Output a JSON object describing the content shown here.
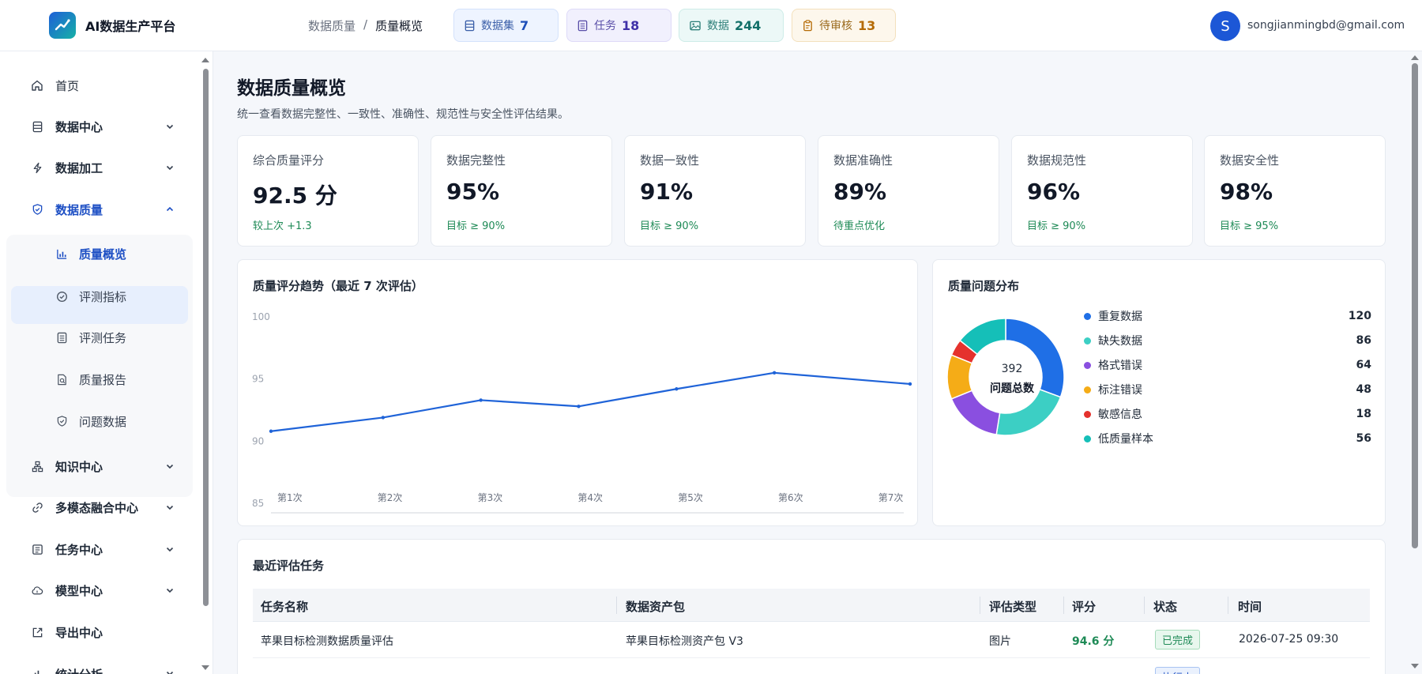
{
  "app": {
    "name": "AI数据生产平台"
  },
  "breadcrumb": {
    "parent": "数据质量",
    "separator": "/",
    "current": "质量概览"
  },
  "header_stats": {
    "datasets": {
      "label": "数据集",
      "value": "7",
      "icon": "database-icon"
    },
    "tasks": {
      "label": "任务",
      "value": "18",
      "icon": "list-icon"
    },
    "data": {
      "label": "数据",
      "value": "244",
      "icon": "image-icon"
    },
    "review": {
      "label": "待审核",
      "value": "13",
      "icon": "clipboard-icon"
    }
  },
  "user": {
    "avatar_letter": "S",
    "email": "songjianmingbd@gmail.com"
  },
  "sidebar": {
    "items": [
      {
        "label": "首页",
        "icon": "home-icon"
      },
      {
        "label": "数据中心",
        "icon": "database-icon"
      },
      {
        "label": "数据加工",
        "icon": "bolt-icon"
      },
      {
        "label": "数据质量",
        "icon": "shield-check-icon"
      },
      {
        "label": "知识中心",
        "icon": "hierarchy-icon"
      },
      {
        "label": "多模态融合中心",
        "icon": "link-icon"
      },
      {
        "label": "任务中心",
        "icon": "task-icon"
      },
      {
        "label": "模型中心",
        "icon": "cloud-icon"
      },
      {
        "label": "导出中心",
        "icon": "export-icon"
      },
      {
        "label": "统计分析",
        "icon": "stats-icon"
      }
    ],
    "quality_sub": [
      {
        "label": "质量概览",
        "icon": "bar-chart-icon"
      },
      {
        "label": "评测指标",
        "icon": "check-circle-icon"
      },
      {
        "label": "评测任务",
        "icon": "list-icon"
      },
      {
        "label": "质量报告",
        "icon": "report-icon"
      },
      {
        "label": "问题数据",
        "icon": "shield-check-icon"
      }
    ]
  },
  "page": {
    "title": "数据质量概览",
    "subtitle": "统一查看数据完整性、一致性、准确性、规范性与安全性评估结果。"
  },
  "metrics": [
    {
      "label": "综合质量评分",
      "value": "92.5 分",
      "foot": "较上次 +1.3"
    },
    {
      "label": "数据完整性",
      "value": "95%",
      "foot": "目标 ≥ 90%"
    },
    {
      "label": "数据一致性",
      "value": "91%",
      "foot": "目标 ≥ 90%"
    },
    {
      "label": "数据准确性",
      "value": "89%",
      "foot": "待重点优化"
    },
    {
      "label": "数据规范性",
      "value": "96%",
      "foot": "目标 ≥ 90%"
    },
    {
      "label": "数据安全性",
      "value": "98%",
      "foot": "目标 ≥ 95%"
    }
  ],
  "colors": {
    "line": "#1f63d8",
    "repeat": "#1f6fe6",
    "missing": "#3ccfc4",
    "format": "#8a4fe0",
    "label_error": "#f5ac17",
    "sensitive": "#e5322d",
    "low_quality": "#15bfb8"
  },
  "chart_data": [
    {
      "type": "line",
      "title": "质量评分趋势（最近 7 次评估）",
      "categories": [
        "第1次",
        "第2次",
        "第3次",
        "第4次",
        "第5次",
        "第6次",
        "第7次"
      ],
      "values": [
        90.8,
        91.9,
        93.3,
        92.8,
        94.2,
        95.5,
        94.6
      ],
      "yticks": [
        "100",
        "95",
        "90",
        "85"
      ],
      "ylim": [
        85,
        100
      ],
      "grid": false
    },
    {
      "type": "pie",
      "title": "质量问题分布",
      "center_value": "392",
      "center_label": "问题总数",
      "slices": [
        {
          "label": "重复数据",
          "value": 120,
          "color": "#1f6fe6"
        },
        {
          "label": "缺失数据",
          "value": 86,
          "color": "#3ccfc4"
        },
        {
          "label": "格式错误",
          "value": 64,
          "color": "#8a4fe0"
        },
        {
          "label": "标注错误",
          "value": 48,
          "color": "#f5ac17"
        },
        {
          "label": "敏感信息",
          "value": 18,
          "color": "#e5322d"
        },
        {
          "label": "低质量样本",
          "value": 56,
          "color": "#15bfb8"
        }
      ],
      "legend": "right"
    }
  ],
  "recent": {
    "title": "最近评估任务",
    "columns": [
      "任务名称",
      "数据资产包",
      "评估类型",
      "评分",
      "状态",
      "时间"
    ],
    "rows": [
      {
        "name": "苹果目标检测数据质量评估",
        "asset": "苹果目标检测资产包 V3",
        "type": "图片",
        "score": "94.6 分",
        "status": "已完成",
        "time": "2026-07-25 09:30"
      },
      {
        "name": "",
        "asset": "",
        "type": "",
        "score": "",
        "status": "执行中",
        "time": ""
      }
    ]
  }
}
